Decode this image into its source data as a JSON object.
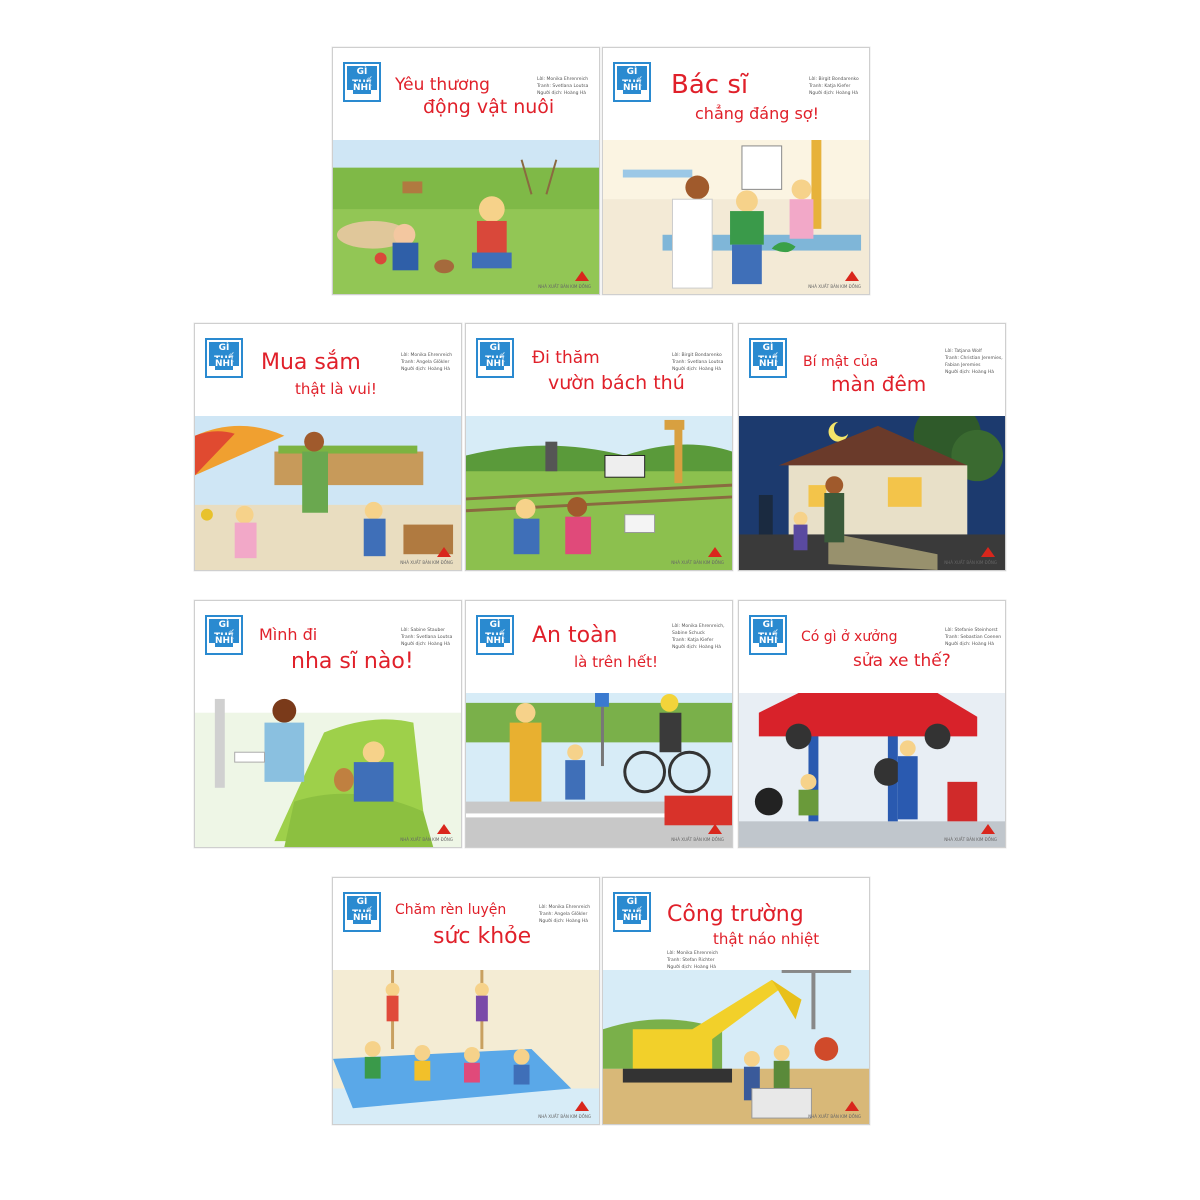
{
  "series": {
    "logo_line1": "GÌ THẾ",
    "logo_line2": "NHỈ",
    "publisher_tag": "NHÀ XUẤT BẢN KIM ĐỒNG"
  },
  "books": [
    {
      "title_line1": "Yêu thương",
      "title_line2": "động vật nuôi",
      "credits": [
        "Lời: Monika Ehrenreich",
        "Tranh: Svetlana Loutsa",
        "Người dịch: Hoàng Hà"
      ]
    },
    {
      "title_line1": "Bác sĩ",
      "title_line2": "chẳng đáng sợ!",
      "credits": [
        "Lời: Birgit Bondarenko",
        "Tranh: Katja Kiefer",
        "Người dịch: Hoàng Hà"
      ]
    },
    {
      "title_line1": "Mua sắm",
      "title_line2": "thật là vui!",
      "credits": [
        "Lời: Monika Ehrenreich",
        "Tranh: Angela Glökler",
        "Người dịch: Hoàng Hà"
      ]
    },
    {
      "title_line1": "Đi thăm",
      "title_line2": "vườn bách thú",
      "credits": [
        "Lời: Birgit Bondarenko",
        "Tranh: Svetlana Loutsa",
        "Người dịch: Hoàng Hà"
      ]
    },
    {
      "title_line1": "Bí mật của",
      "title_line2": "màn đêm",
      "credits": [
        "Lời: Tatjana Wolf",
        "Tranh: Christian Jeremies,",
        "Fabian Jeremies",
        "Người dịch: Hoàng Hà"
      ]
    },
    {
      "title_line1": "Mình đi",
      "title_line2": "nha sĩ nào!",
      "credits": [
        "Lời: Sabine Stauber",
        "Tranh: Svetlana Loutsa",
        "Người dịch: Hoàng Hà"
      ]
    },
    {
      "title_line1": "An toàn",
      "title_line2": "là trên hết!",
      "credits": [
        "Lời: Monika Ehrenreich,",
        "Sabine Schuck",
        "Tranh: Katja Kiefer",
        "Người dịch: Hoàng Hà"
      ]
    },
    {
      "title_line1": "Có gì ở xưởng",
      "title_line2": "sửa xe thế?",
      "credits": [
        "Lời: Stefanie Steinhorst",
        "Tranh: Sebastian Coenen",
        "Người dịch: Hoàng Hà"
      ]
    },
    {
      "title_line1": "Chăm rèn luyện",
      "title_line2": "sức khỏe",
      "credits": [
        "Lời: Monika Ehrenreich",
        "Tranh: Angela Glökler",
        "Người dịch: Hoàng Hà"
      ]
    },
    {
      "title_line1": "Công trường",
      "title_line2": "thật náo nhiệt",
      "credits": [
        "Lời: Monika Ehrenreich",
        "Tranh: Stefan Richter",
        "Người dịch: Hoàng Hà"
      ]
    }
  ],
  "colors": {
    "title_red": "#e0202a",
    "logo_blue": "#2a8ad0"
  }
}
